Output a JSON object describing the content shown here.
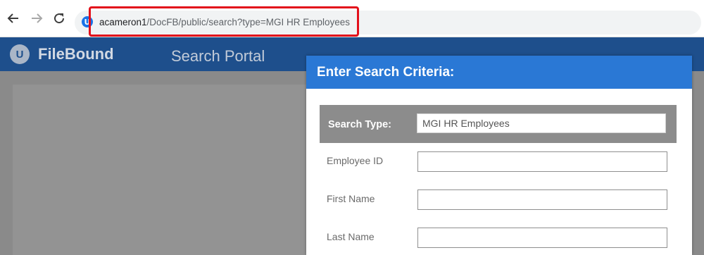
{
  "browser": {
    "url_host": "acameron1",
    "url_path": "/DocFB/public/search?type=MGI HR Employees",
    "site_icon_letter": "U"
  },
  "app": {
    "logo_letter": "U",
    "brand": "FileBound",
    "portal_title": "Search Portal"
  },
  "dialog": {
    "title": "Enter Search Criteria:",
    "search_type_label": "Search Type:",
    "search_type_value": "MGI HR Employees",
    "fields": [
      {
        "label": "Employee ID",
        "value": ""
      },
      {
        "label": "First Name",
        "value": ""
      },
      {
        "label": "Last Name",
        "value": ""
      }
    ]
  },
  "colors": {
    "header_bg": "#1e4f8c",
    "dialog_header_bg": "#2a78d5",
    "highlight": "#e3101b"
  }
}
